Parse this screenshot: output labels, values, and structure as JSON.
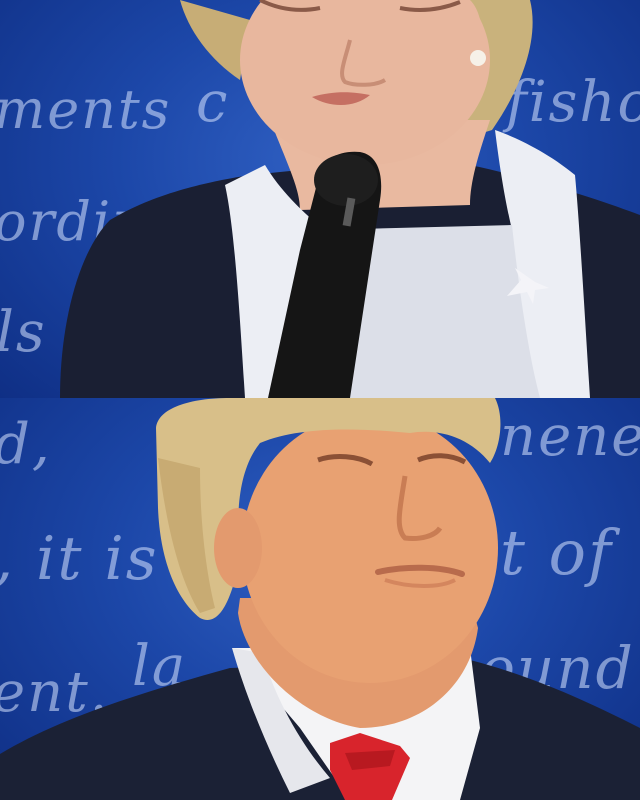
{
  "top_frame": {
    "backdrop_words": [
      "ments",
      "c",
      "fisho",
      "ordin",
      "ls"
    ],
    "colors": {
      "backdrop": "#1c47a8",
      "jacket": "#1a1f33",
      "collar": "#eceef4",
      "microphone": "#151515"
    }
  },
  "bottom_frame": {
    "backdrop_words": [
      "d,",
      "nene",
      ", it is",
      "t of",
      "ent.",
      "la",
      "ound"
    ],
    "colors": {
      "backdrop": "#1c47a8",
      "suit": "#1b2135",
      "shirt": "#f4f4f6",
      "tie": "#d8242c"
    }
  }
}
